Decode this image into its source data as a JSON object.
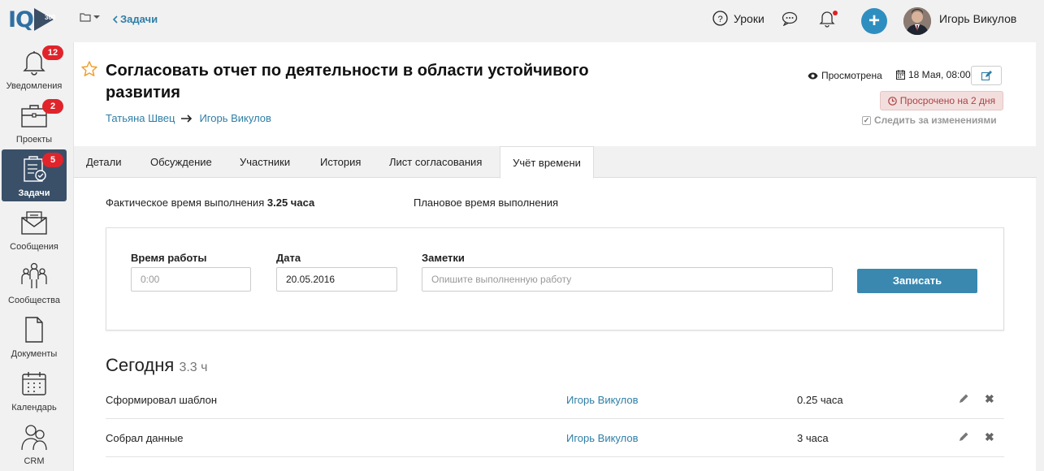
{
  "header": {
    "logo_text": "IQ",
    "logo_number": "300",
    "back_label": "Задачи",
    "lessons_label": "Уроки",
    "user_name": "Игорь Викулов"
  },
  "sidebar": {
    "items": [
      {
        "label": "Уведомления",
        "badge": "12",
        "icon": "bell-icon"
      },
      {
        "label": "Проекты",
        "badge": "2",
        "icon": "briefcase-icon"
      },
      {
        "label": "Задачи",
        "badge": "5",
        "icon": "clipboard-check-icon",
        "active": true
      },
      {
        "label": "Сообщения",
        "icon": "envelope-icon"
      },
      {
        "label": "Сообщества",
        "icon": "community-icon"
      },
      {
        "label": "Документы",
        "icon": "document-icon"
      },
      {
        "label": "Календарь",
        "icon": "calendar-icon"
      },
      {
        "label": "CRM",
        "icon": "crm-icon"
      }
    ]
  },
  "task": {
    "title": "Согласовать отчет по деятельности в области устойчивого развития",
    "from_person": "Татьяна Швец",
    "to_person": "Игорь Викулов",
    "viewed_label": "Просмотрена",
    "date_label": "18 Мая, 08:00",
    "overdue_label": "Просрочено на 2 дня",
    "follow_label": "Следить за изменениями"
  },
  "tabs": [
    "Детали",
    "Обсуждение",
    "Участники",
    "История",
    "Лист согласования",
    "Учёт времени"
  ],
  "time": {
    "fact_label": "Фактическое время выполнения",
    "fact_value": "3.25 часа",
    "plan_label": "Плановое время выполнения"
  },
  "form": {
    "work_time_label": "Время работы",
    "work_time_placeholder": "0:00",
    "date_label": "Дата",
    "date_value": "20.05.2016",
    "notes_label": "Заметки",
    "notes_placeholder": "Опишите выполненную работу",
    "submit_label": "Записать"
  },
  "today": {
    "heading": "Сегодня",
    "hours": "3.3 ч",
    "entries": [
      {
        "description": "Сформировал шаблон",
        "user": "Игорь Викулов",
        "duration": "0.25 часа"
      },
      {
        "description": "Собрал данные",
        "user": "Игорь Викулов",
        "duration": "3 часа"
      }
    ]
  },
  "colors": {
    "accent": "#2f7ea6",
    "sidebar_active": "#3a5069",
    "badge": "#e0242c",
    "button": "#3a88b0"
  }
}
